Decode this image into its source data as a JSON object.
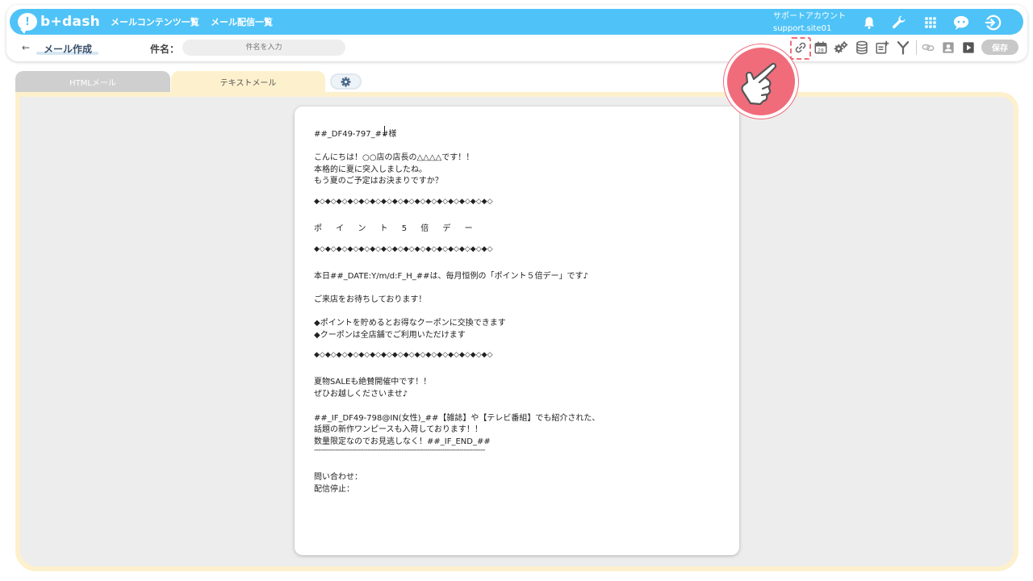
{
  "app": {
    "logo_text": "b+dash",
    "logo_mark": "!"
  },
  "nav": {
    "link1": "メールコンテンツ一覧",
    "link2": "メール配信一覧"
  },
  "account": {
    "label": "サポートアカウント",
    "site": "support.site01"
  },
  "page": {
    "back_arrow": "←",
    "title": "メール作成"
  },
  "subject": {
    "label": "件名：",
    "placeholder": "件名を入力"
  },
  "toolbar": {
    "calendar_day": "28",
    "save_label": "保存"
  },
  "tabs": {
    "html": "HTMLメール",
    "text": "テキストメール"
  },
  "mail_body": [
    "##_DF49-797_##様",
    "",
    "こんにちは！○○店の店長の△△△△です！！",
    "本格的に夏に突入しましたね。",
    "もう夏のご予定はお決まりですか？",
    "",
    "◆◇◆◇◆◇◆◇◆◇◆◇◆◇◆◇◆◇◆◇◆◇◆◇◆◇◆◇◆◇◆◇",
    "",
    "ポ イ ン ト 5 倍 デ ー",
    "",
    "◆◇◆◇◆◇◆◇◆◇◆◇◆◇◆◇◆◇◆◇◆◇◆◇◆◇◆◇◆◇◆◇",
    "",
    "本日##_DATE:Y/m/d:F_H_##は、毎月恒例の「ポイント５倍デー」です♪",
    "",
    "ご来店をお待ちしております！",
    "",
    "◆ポイントを貯めるとお得なクーポンに交換できます",
    "◆クーポンは全店舗でご利用いただけます",
    "",
    "◆◇◆◇◆◇◆◇◆◇◆◇◆◇◆◇◆◇◆◇◆◇◆◇◆◇◆◇◆◇◆◇",
    "",
    "夏物SALEも絶賛開催中です！！",
    "ぜひお越しくださいませ♪",
    "",
    "##_IF_DF49-798@IN(女性)_##【雑誌】や【テレビ番組】でも紹介された、",
    "話題の新作ワンピースも入荷しております！！",
    "数量限定なのでお見逃しなく！##_IF_END_##",
    "--------------------------------------------------------------------------------",
    "",
    "問い合わせ：",
    "配信停止："
  ],
  "colors": {
    "topbar": "#4fc3f7",
    "tab_active": "#fdf0cc",
    "tab_inactive": "#cfcfcf",
    "highlight": "#f06c7b",
    "save_disabled": "#c8c8c8"
  }
}
